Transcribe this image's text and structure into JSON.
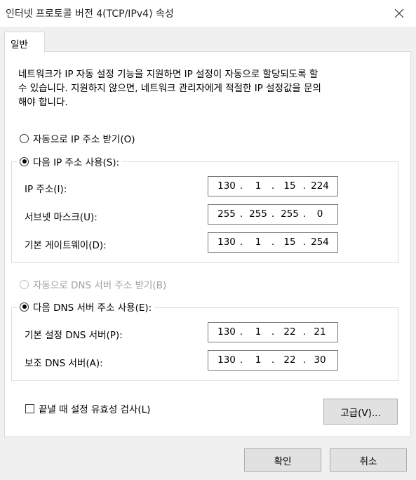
{
  "window": {
    "title": "인터넷 프로토콜 버전 4(TCP/IPv4) 속성",
    "close_icon": "close-icon"
  },
  "tabs": [
    {
      "label": "일반"
    }
  ],
  "general": {
    "description_line1": "네트워크가 IP 자동 설정 기능을 지원하면 IP 설정이 자동으로 할당되도록 할",
    "description_line2": "수 있습니다. 지원하지 않으면, 네트워크 관리자에게 적절한 IP 설정값을 문의",
    "description_line3": "해야 합니다.",
    "ip_auto_radio": {
      "label": "자동으로 IP 주소 받기(O)",
      "checked": false
    },
    "ip_manual_radio": {
      "label": "다음 IP 주소 사용(S):",
      "checked": true
    },
    "ip_fields": {
      "ip_address": {
        "label": "IP 주소(I):",
        "octets": [
          "130",
          "1",
          "15",
          "224"
        ]
      },
      "subnet_mask": {
        "label": "서브넷 마스크(U):",
        "octets": [
          "255",
          "255",
          "255",
          "0"
        ]
      },
      "default_gateway": {
        "label": "기본 게이트웨이(D):",
        "octets": [
          "130",
          "1",
          "15",
          "254"
        ]
      }
    },
    "dns_auto_radio": {
      "label": "자동으로 DNS 서버 주소 받기(B)",
      "checked": false,
      "disabled": true
    },
    "dns_manual_radio": {
      "label": "다음 DNS 서버 주소 사용(E):",
      "checked": true
    },
    "dns_fields": {
      "preferred_dns": {
        "label": "기본 설정 DNS 서버(P):",
        "octets": [
          "130",
          "1",
          "22",
          "21"
        ]
      },
      "alternate_dns": {
        "label": "보조 DNS 서버(A):",
        "octets": [
          "130",
          "1",
          "22",
          "30"
        ]
      }
    },
    "validate_checkbox": {
      "label": "끝낼 때 설정 유효성 검사(L)",
      "checked": false
    },
    "advanced_button": "고급(V)..."
  },
  "footer": {
    "ok_button": "확인",
    "cancel_button": "취소"
  }
}
